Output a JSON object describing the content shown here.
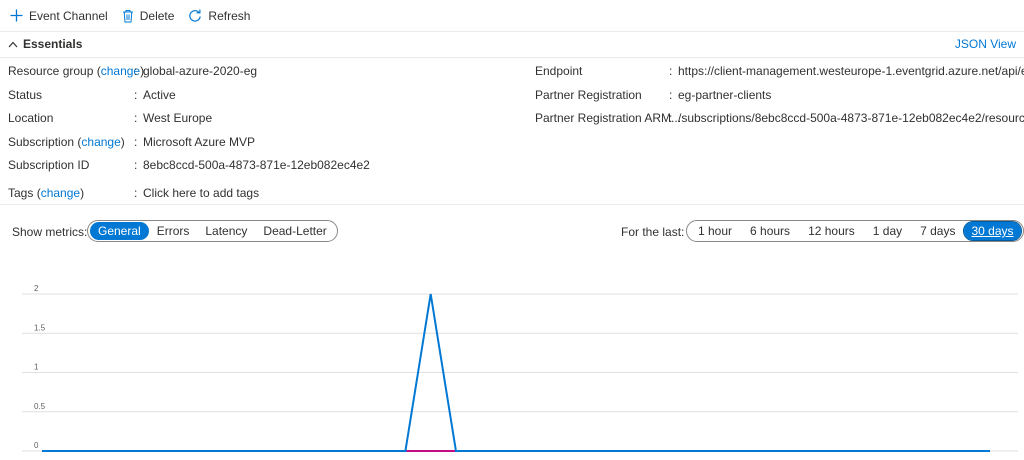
{
  "toolbar": {
    "event_channel": "Event Channel",
    "delete": "Delete",
    "refresh": "Refresh"
  },
  "essentials": {
    "title": "Essentials",
    "json_view": "JSON View"
  },
  "left_props": [
    {
      "key": "Resource group",
      "change": "change",
      "value": "global-azure-2020-eg",
      "value_link": true
    },
    {
      "key": "Status",
      "value": "Active"
    },
    {
      "key": "Location",
      "value": "West Europe"
    },
    {
      "key": "Subscription",
      "change": "change",
      "value": "Microsoft Azure MVP",
      "value_link": true
    },
    {
      "key": "Subscription ID",
      "value": "8ebc8ccd-500a-4873-871e-12eb082ec4e2"
    },
    {
      "key": "Tags",
      "change": "change",
      "value": "Click here to add tags",
      "value_link": true
    }
  ],
  "right_props": [
    {
      "key": "Endpoint",
      "value": "https://client-management.westeurope-1.eventgrid.azure.net/api/e..."
    },
    {
      "key": "Partner Registration",
      "value": "eg-partner-clients",
      "value_link": true
    },
    {
      "key": "Partner Registration ARM...",
      "value": "/subscriptions/8ebc8ccd-500a-4873-871e-12eb082ec4e2/resource..."
    }
  ],
  "metrics": {
    "label": "Show metrics:",
    "options": [
      "General",
      "Errors",
      "Latency",
      "Dead-Letter"
    ],
    "selected": "General"
  },
  "timeframe": {
    "label": "For the last:",
    "options": [
      "1 hour",
      "6 hours",
      "12 hours",
      "1 day",
      "7 days",
      "30 days"
    ],
    "selected": "30 days"
  },
  "colors": {
    "accent": "#0078d4",
    "series_blue": "#0078d4",
    "series_magenta": "#c30b82"
  },
  "chart_data": {
    "type": "line",
    "y_ticks": [
      "2",
      "1.5",
      "1",
      "0.5",
      "0"
    ],
    "ylim": [
      0,
      2
    ],
    "xlim": [
      0,
      30
    ],
    "series": [
      {
        "values": [
          [
            0,
            0
          ],
          [
            11.5,
            0
          ],
          [
            12.3,
            2
          ],
          [
            13.1,
            0
          ],
          [
            30,
            0
          ]
        ],
        "color": "#0078d4"
      },
      {
        "values": [
          [
            0,
            0
          ],
          [
            30,
            0
          ]
        ],
        "color": "#c30b82"
      }
    ]
  }
}
